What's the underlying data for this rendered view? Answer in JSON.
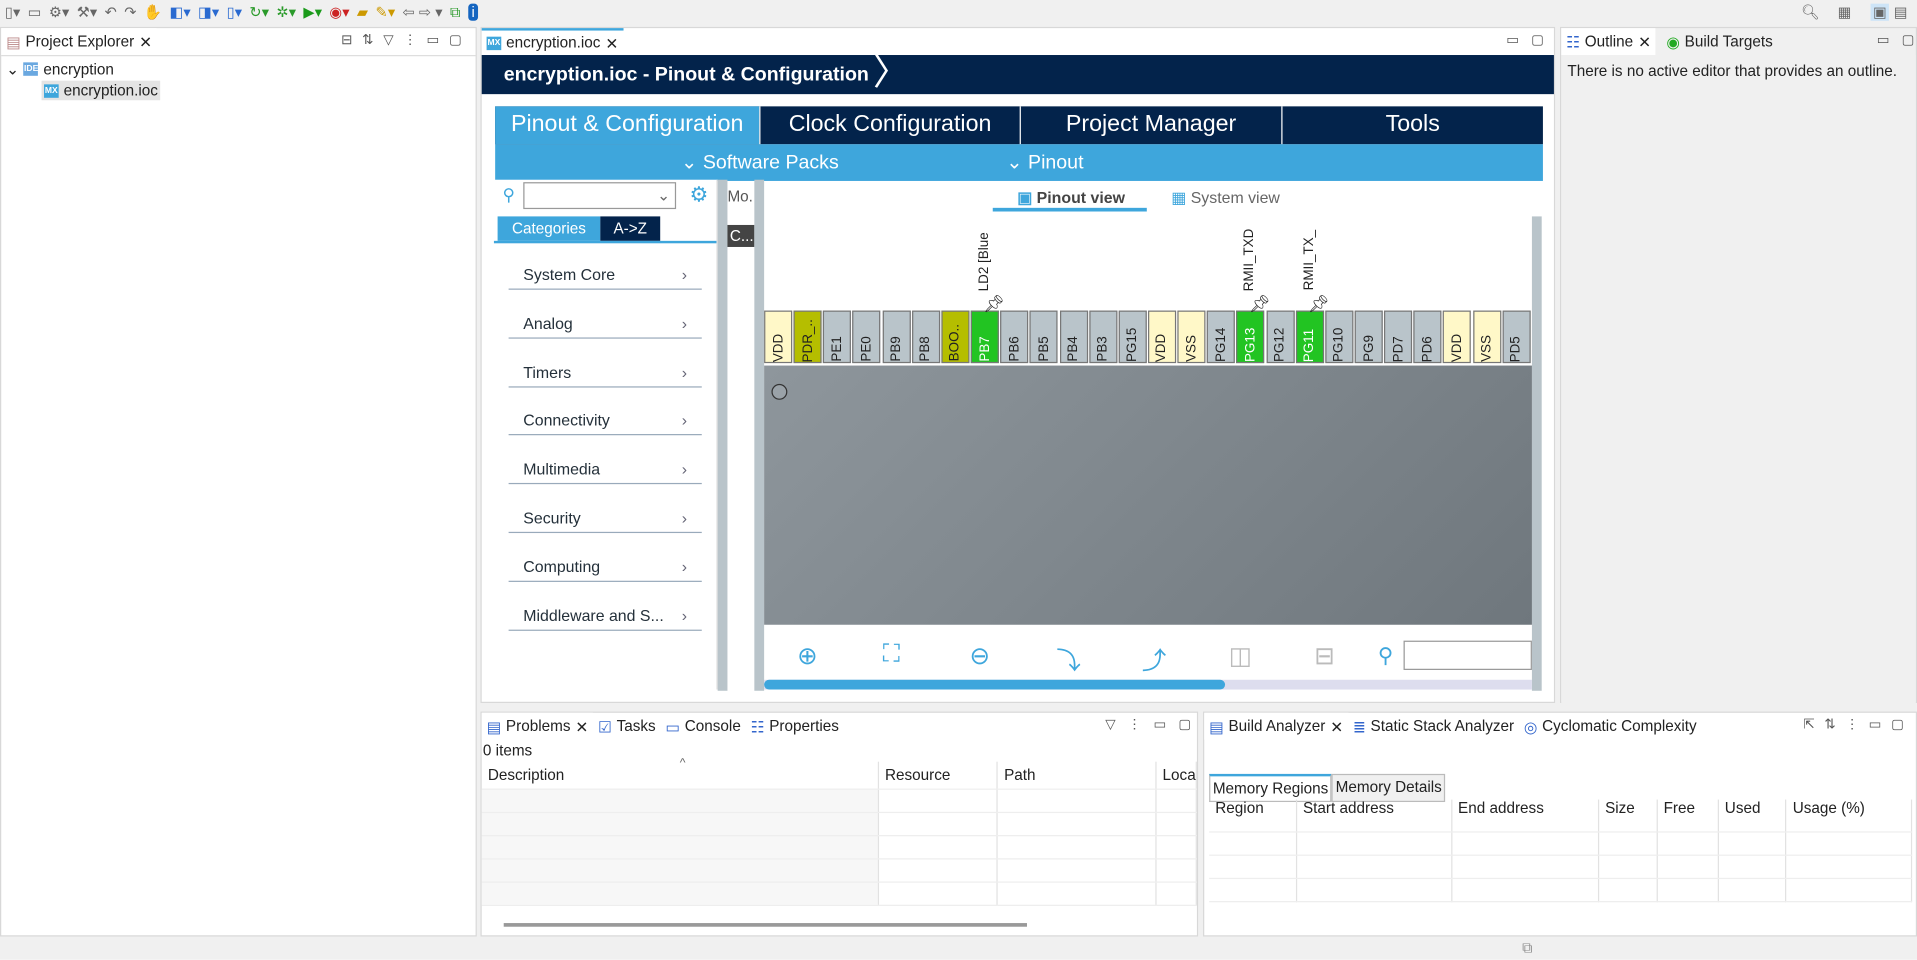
{
  "toolbar": {
    "icons": [
      "new-icon",
      "save-icon",
      "save-all-icon",
      "settings-icon",
      "build-hammer-icon",
      "undo-icon",
      "redo-icon",
      "pin-icon",
      "debug-icon",
      "new-class-icon",
      "new-file-icon",
      "new-header-icon",
      "refresh-icon",
      "bug-debug-icon",
      "run-icon",
      "run-external-icon",
      "open-folder-icon",
      "pencil-icon",
      "info-icon",
      "search-icon",
      "perspective-icon",
      "cubemx-icon"
    ]
  },
  "project_explorer": {
    "title": "Project Explorer",
    "tree": [
      {
        "label": "encryption",
        "icon": "IDE"
      },
      {
        "label": "encryption.ioc",
        "icon": "MX"
      }
    ]
  },
  "editor": {
    "tab": "encryption.ioc",
    "breadcrumb": "encryption.ioc - Pinout & Configuration",
    "main_tabs": [
      "Pinout & Configuration",
      "Clock Configuration",
      "Project Manager",
      "Tools"
    ],
    "sub_tabs": [
      "Software Packs",
      "Pinout"
    ],
    "search_placeholder": "",
    "cat_tabs": [
      "Categories",
      "A->Z"
    ],
    "categories": [
      "System Core",
      "Analog",
      "Timers",
      "Connectivity",
      "Multimedia",
      "Security",
      "Computing",
      "Middleware and S..."
    ],
    "mode_label": "Mo.",
    "config_label": "C...",
    "view_tabs": [
      "Pinout view",
      "System view"
    ],
    "pins": [
      {
        "name": "VDD",
        "type": "power"
      },
      {
        "name": "PDR_..",
        "type": "reset"
      },
      {
        "name": "PE1",
        "type": "io"
      },
      {
        "name": "PE0",
        "type": "io"
      },
      {
        "name": "PB9",
        "type": "io"
      },
      {
        "name": "PB8",
        "type": "io"
      },
      {
        "name": "BOO..",
        "type": "reset"
      },
      {
        "name": "PB7",
        "type": "used",
        "label": "LD2 [Blue"
      },
      {
        "name": "PB6",
        "type": "io"
      },
      {
        "name": "PB5",
        "type": "io"
      },
      {
        "name": "PB4",
        "type": "io"
      },
      {
        "name": "PB3",
        "type": "io"
      },
      {
        "name": "PG15",
        "type": "io"
      },
      {
        "name": "VDD",
        "type": "power"
      },
      {
        "name": "VSS",
        "type": "power"
      },
      {
        "name": "PG14",
        "type": "io"
      },
      {
        "name": "PG13",
        "type": "used",
        "label": "RMII_TXD"
      },
      {
        "name": "PG12",
        "type": "io"
      },
      {
        "name": "PG11",
        "type": "used",
        "label": "RMII_TX_"
      },
      {
        "name": "PG10",
        "type": "io"
      },
      {
        "name": "PG9",
        "type": "io"
      },
      {
        "name": "PD7",
        "type": "io"
      },
      {
        "name": "PD6",
        "type": "io"
      },
      {
        "name": "VDD",
        "type": "power"
      },
      {
        "name": "VSS",
        "type": "power"
      },
      {
        "name": "PD5",
        "type": "io"
      }
    ],
    "pin_colors": {
      "power": "#fff8c8",
      "reset": "#b5be00",
      "io": "#b9c4ca",
      "used": "#22c422"
    },
    "horizontal_scroll_fraction": 0.6
  },
  "outline": {
    "tabs": [
      "Outline",
      "Build Targets"
    ],
    "message": "There is no active editor that provides an outline."
  },
  "problems": {
    "tabs": [
      "Problems",
      "Tasks",
      "Console",
      "Properties"
    ],
    "count": "0 items",
    "columns": [
      "Description",
      "Resource",
      "Path",
      "Loca"
    ]
  },
  "build_analyzer": {
    "tabs": [
      "Build Analyzer",
      "Static Stack Analyzer",
      "Cyclomatic Complexity"
    ],
    "sub_tabs": [
      "Memory Regions",
      "Memory Details"
    ],
    "columns": [
      "Region",
      "Start address",
      "End address",
      "Size",
      "Free",
      "Used",
      "Usage (%)"
    ]
  }
}
